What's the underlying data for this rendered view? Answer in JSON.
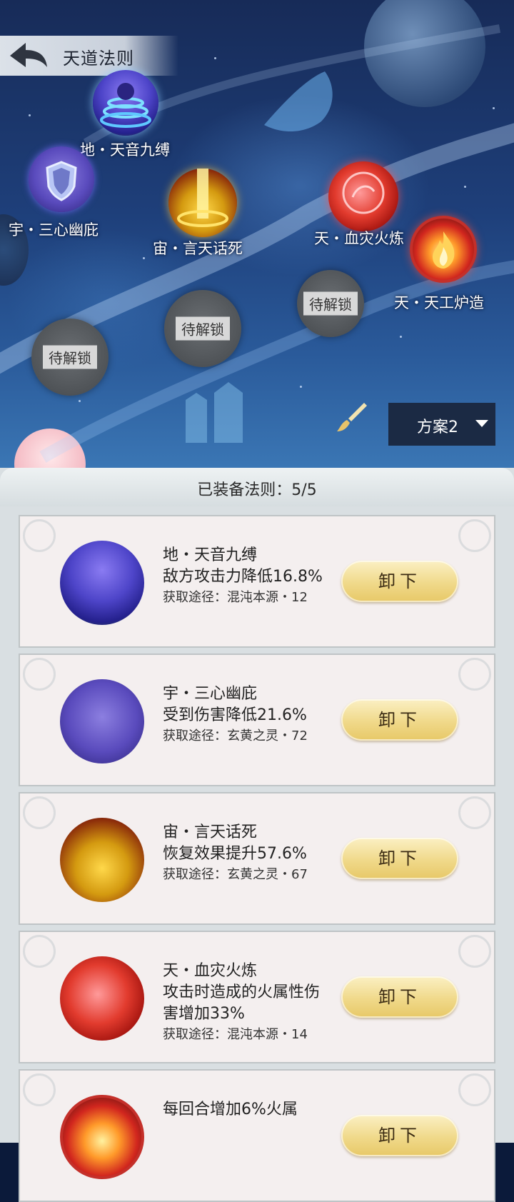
{
  "header": {
    "title": "天道法则"
  },
  "map": {
    "nodes": [
      {
        "label": "地・天音九缚",
        "icon": "whirlwind-icon"
      },
      {
        "label": "宇・三心幽庇",
        "icon": "shield-icon"
      },
      {
        "label": "宙・言天话死",
        "icon": "light-beam-icon"
      },
      {
        "label": "天・血灾火炼",
        "icon": "blood-orb-icon"
      },
      {
        "label": "天・天工炉造",
        "icon": "flame-icon"
      }
    ],
    "locked_label": "待解锁",
    "scheme": {
      "label": "方案2",
      "icon": "chevron-down-icon"
    },
    "brush_icon": "brush-icon"
  },
  "panel": {
    "equipped_label": "已装备法则：5/5",
    "unload_label": "卸下",
    "cards": [
      {
        "name": "地・天音九缚",
        "desc": "敌方攻击力降低16.8%",
        "source": "获取途径：混沌本源・12"
      },
      {
        "name": "宇・三心幽庇",
        "desc": "受到伤害降低21.6%",
        "source": "获取途径：玄黄之灵・72"
      },
      {
        "name": "宙・言天话死",
        "desc": "恢复效果提升57.6%",
        "source": "获取途径：玄黄之灵・67"
      },
      {
        "name": "天・血灾火炼",
        "desc": "攻击时造成的火属性伤害增加33%",
        "source": "获取途径：混沌本源・14"
      },
      {
        "name": "",
        "desc": "每回合增加6%火属",
        "source": ""
      }
    ]
  },
  "colors": {
    "map_bg": "#1e3f7a",
    "panel_bg": "#d9dfe2",
    "button_gold": "#f0d98a",
    "scheme_bg": "#1b2a44"
  }
}
